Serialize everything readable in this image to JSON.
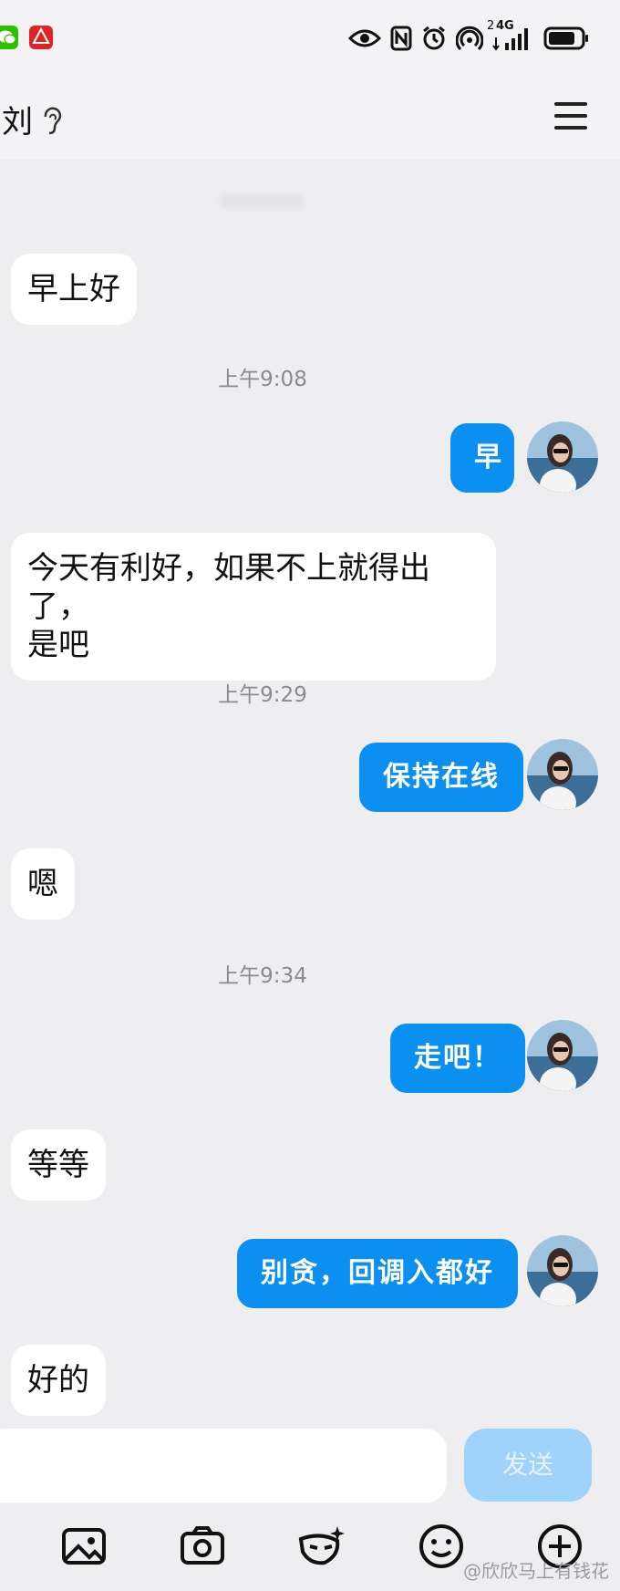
{
  "header": {
    "title": "刘"
  },
  "messages": [
    {
      "dir": "in",
      "text": "早上好"
    },
    {
      "type": "time",
      "text": "上午9:08"
    },
    {
      "dir": "out",
      "text": "早"
    },
    {
      "dir": "in",
      "text_line1": "今天有利好，如果不上就得出了，",
      "text_line2": "是吧"
    },
    {
      "type": "time",
      "text": "上午9:29"
    },
    {
      "dir": "out",
      "text": "保持在线"
    },
    {
      "dir": "in",
      "text": "嗯"
    },
    {
      "type": "time",
      "text": "上午9:34"
    },
    {
      "dir": "out",
      "text": "走吧！"
    },
    {
      "dir": "in",
      "text": "等等"
    },
    {
      "dir": "out",
      "text": "别贪，回调入都好"
    },
    {
      "dir": "in",
      "text": "好的"
    }
  ],
  "input": {
    "placeholder": "",
    "send_label": "发送"
  },
  "status": {
    "network": "4G",
    "sim": "2"
  },
  "colors": {
    "outgoing_bubble": "#0b8ff0",
    "send_disabled": "#9fd3fb",
    "background": "#eeeef1"
  },
  "watermark": "@欣欣马上有钱花"
}
